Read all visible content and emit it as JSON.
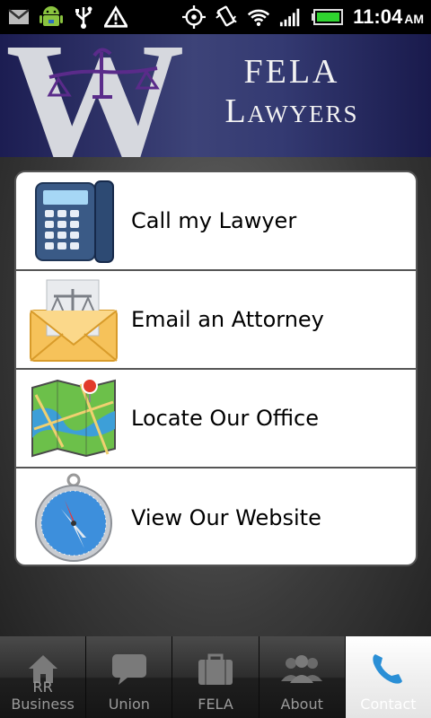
{
  "status_bar": {
    "time": "11:04",
    "ampm": "AM",
    "icons": [
      "gmail-icon",
      "android-debug-icon",
      "usb-icon",
      "warning-icon",
      "gps-icon",
      "vibrate-icon",
      "wifi-icon",
      "signal-icon",
      "battery-icon"
    ]
  },
  "header": {
    "brand_line1": "FELA",
    "brand_line2": "Lawyers",
    "logo_letter": "W"
  },
  "menu": {
    "items": [
      {
        "label": "Call my Lawyer",
        "icon": "phone-icon"
      },
      {
        "label": "Email an Attorney",
        "icon": "envelope-scales-icon"
      },
      {
        "label": "Locate Our Office",
        "icon": "map-icon"
      },
      {
        "label": "View Our Website",
        "icon": "compass-icon"
      }
    ]
  },
  "tabs": [
    {
      "label": "RR Business",
      "icon": "home-icon"
    },
    {
      "label": "Union",
      "icon": "chat-bubble-icon"
    },
    {
      "label": "FELA",
      "icon": "briefcase-icon"
    },
    {
      "label": "About",
      "icon": "people-icon"
    },
    {
      "label": "Contact",
      "icon": "phone-handset-icon",
      "active": true
    }
  ],
  "colors": {
    "header_dark": "#1c1d52",
    "header_mid": "#3d4378",
    "active_tab_icon": "#2a8fd6"
  }
}
